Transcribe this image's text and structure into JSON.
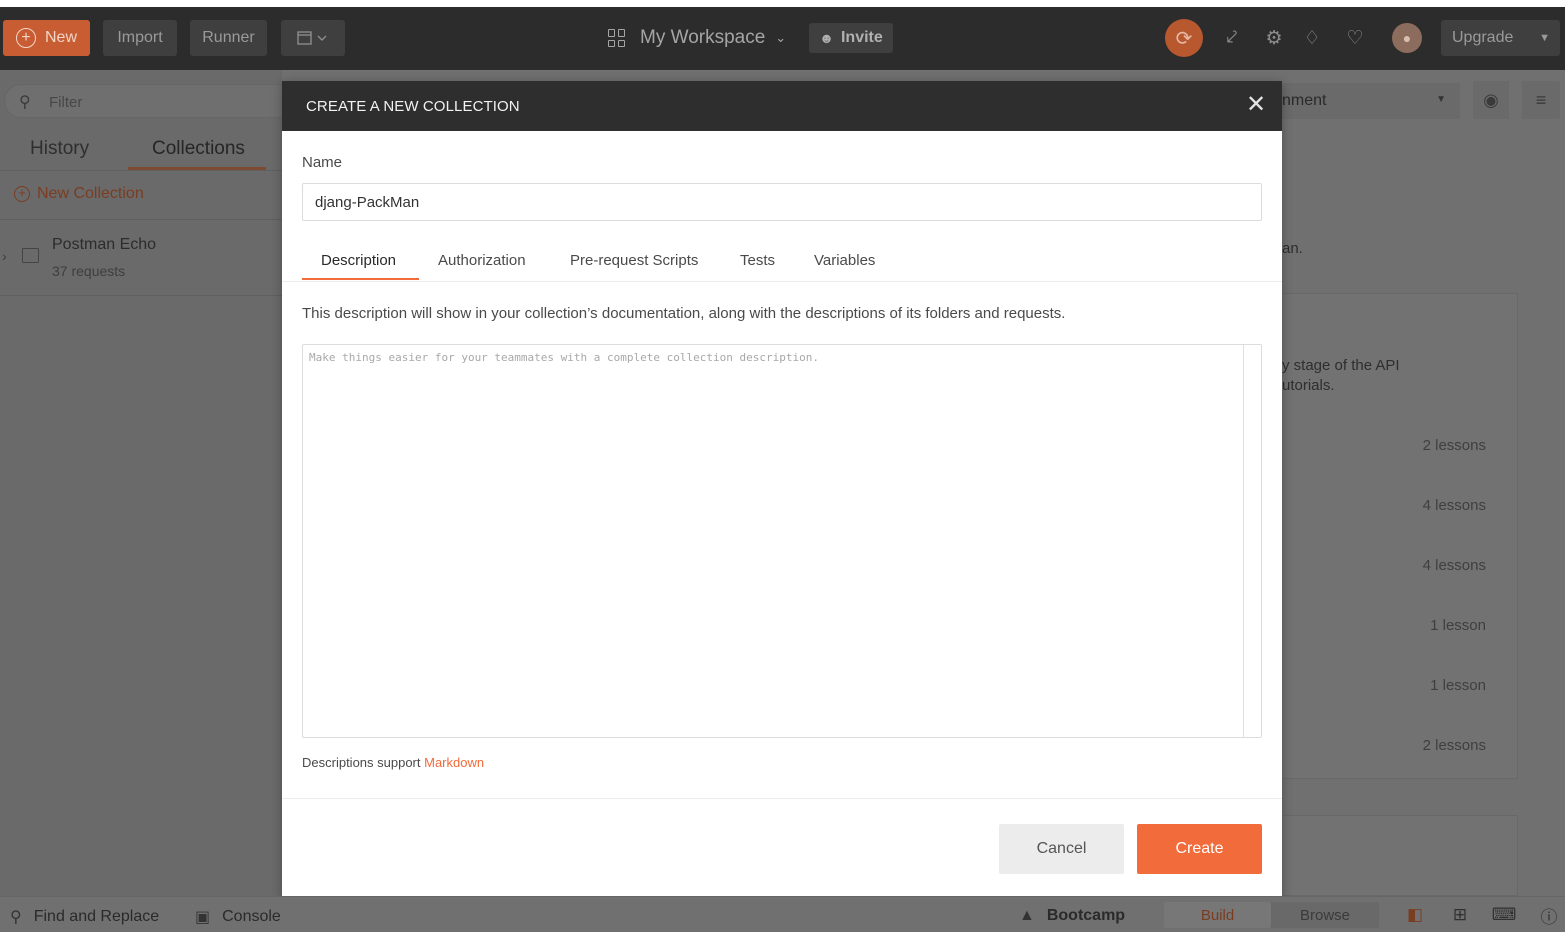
{
  "header": {
    "new_label": "New",
    "import_label": "Import",
    "runner_label": "Runner",
    "workspace_label": "My Workspace",
    "invite_label": "Invite",
    "upgrade_label": "Upgrade"
  },
  "sidebar": {
    "filter_placeholder": "Filter",
    "tabs": [
      "History",
      "Collections"
    ],
    "active_tab": "Collections",
    "new_collection_label": "New Collection",
    "collections": [
      {
        "name": "Postman Echo",
        "count": "37 requests"
      }
    ]
  },
  "background": {
    "environment_partial": "nment",
    "text_an": "an.",
    "text_stage": "y stage of the API",
    "text_tutorials": "utorials.",
    "lessons": [
      "2 lessons",
      "4 lessons",
      "4 lessons",
      "1 lesson",
      "1 lesson",
      "2 lessons"
    ]
  },
  "modal": {
    "title": "CREATE A NEW COLLECTION",
    "name_label": "Name",
    "name_value": "djang-PackMan",
    "tabs": [
      "Description",
      "Authorization",
      "Pre-request Scripts",
      "Tests",
      "Variables"
    ],
    "active_tab": "Description",
    "description_help": "This description will show in your collection’s documentation, along with the descriptions of its folders and requests.",
    "description_placeholder": "Make things easier for your teammates with a complete collection description.",
    "markdown_note": "Descriptions support",
    "markdown_link": "Markdown",
    "cancel_label": "Cancel",
    "create_label": "Create"
  },
  "statusbar": {
    "find_replace_label": "Find and Replace",
    "console_label": "Console",
    "bootcamp_label": "Bootcamp",
    "build_label": "Build",
    "browse_label": "Browse"
  },
  "colors": {
    "accent": "#f26b3a",
    "header_bg": "#2c2c2c",
    "modal_header_bg": "#2e2e2e"
  }
}
